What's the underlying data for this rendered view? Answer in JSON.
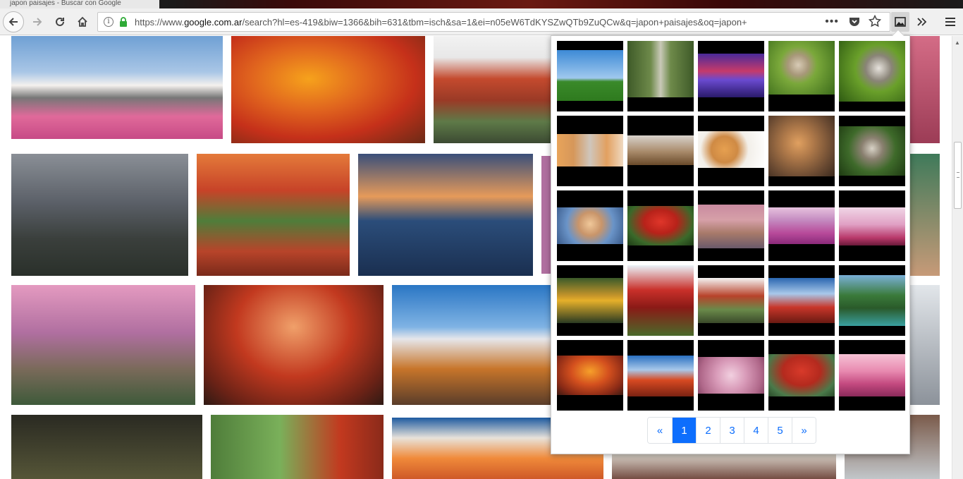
{
  "browser": {
    "tab_title": "japon paisajes - Buscar con Google",
    "url_prefix": "https://www.",
    "url_domain": "google.com.ar",
    "url_rest": "/search?hl=es-419&biw=1366&bih=631&tbm=isch&sa=1&ei=n05eW6TdKYSZwQTb9ZuQCw&q=japon+paisajes&oq=japon+",
    "dots": "•••",
    "icons": {
      "back": "arrow-left-icon",
      "forward": "arrow-right-icon",
      "reload": "reload-icon",
      "home": "home-icon",
      "info": "info-icon",
      "lock": "lock-icon",
      "pocket": "pocket-icon",
      "bookmark": "star-icon",
      "extension": "image-gallery-icon",
      "overflow": "chevron-double-right-icon",
      "menu": "hamburger-menu-icon"
    }
  },
  "results_grid": {
    "description_colors": [
      "#e06a9a",
      "#d8471f",
      "#c44a2e",
      "#5b6068",
      "#b8442a",
      "#2b4d7a",
      "#b06fa0",
      "#a8482c",
      "#c2391f",
      "#5a3d2a",
      "#4f7d3a",
      "#1d5aa0",
      "#5a2a20",
      "#7a5a4a"
    ]
  },
  "panel": {
    "grid": [
      [
        "sky-field",
        "road-trees",
        "purple-lake",
        "kitten-grass",
        "cat-leaves"
      ],
      [
        "three-kittens",
        "cat-lying",
        "kitten-playing",
        "ginger-cat",
        "cat-green"
      ],
      [
        "kitten-blanket",
        "red-maple-garden",
        "pink-tree-path",
        "pink-mountain",
        "castle-blossom"
      ],
      [
        "golden-temple",
        "red-temple",
        "red-bridge-temple",
        "fuji-pagoda",
        "lake-tree"
      ],
      [
        "autumn-temple",
        "fuji-red",
        "pink-blossom",
        "temple-garden",
        "pink-path"
      ]
    ],
    "pagination": {
      "prev": "«",
      "pages": [
        "1",
        "2",
        "3",
        "4",
        "5"
      ],
      "active_page": "1",
      "next": "»"
    }
  },
  "colors": {
    "accent": "#0d6efd",
    "lock_green": "#2eaa37"
  }
}
